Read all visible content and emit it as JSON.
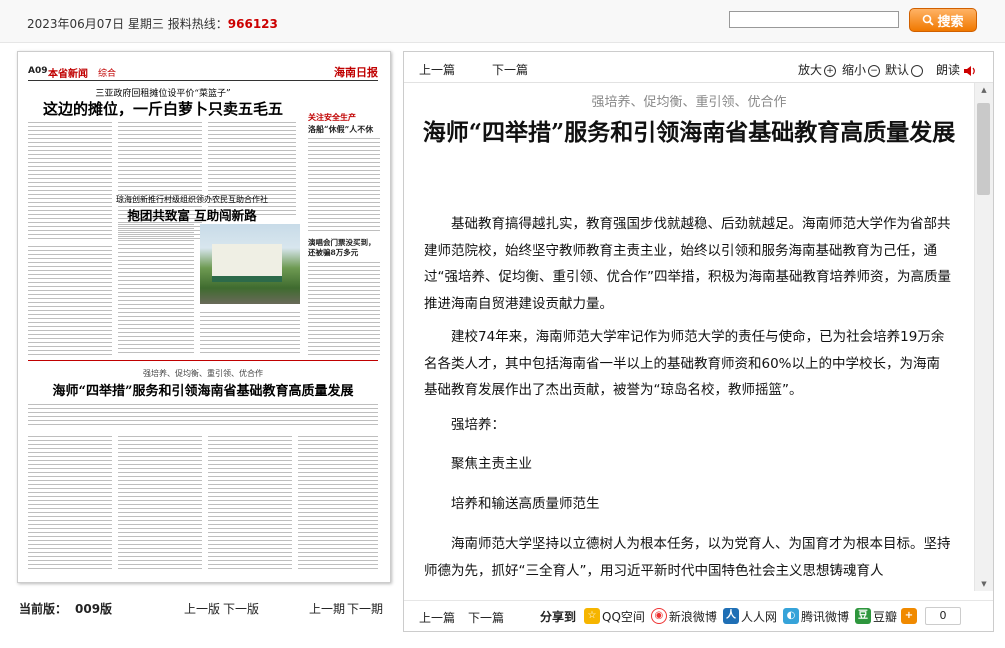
{
  "topbar": {
    "date": "2023年06月07日",
    "weekday": "星期三",
    "hotline_label": "报料热线：",
    "hotline_number": "966123",
    "search_placeholder": "",
    "search_button": "搜索"
  },
  "paper": {
    "page_code": "A09",
    "section": "本省新闻",
    "section_sub": "综合",
    "masthead": "海南日报",
    "headline1_kicker": "三亚政府回租摊位设平价“菜篮子”",
    "headline1": "这边的摊位，一斤白萝卜只卖五毛五",
    "headline2_kicker": "琼海创新推行村级组织领办农民互助合作社",
    "headline2": "抱团共致富 互助闯新路",
    "right_column_kicker": "关注安全生产",
    "right_column_title": "洛船“休假”人不休",
    "right_column_title2": "演唱会门票没买到，还被骗8万多元",
    "main_kicker": "强培养、促均衡、重引领、优合作",
    "main_headline": "海师“四举措”服务和引领海南省基础教育高质量发展"
  },
  "left_nav": {
    "current_label": "当前版：",
    "current_value": "009版",
    "prev_page": "上一版",
    "next_page": "下一版",
    "prev_issue": "上一期",
    "next_issue": "下一期"
  },
  "toolbar": {
    "prev_article": "上一篇",
    "next_article": "下一篇",
    "zoom_in": "放大",
    "zoom_out": "缩小",
    "default": "默认",
    "read_aloud": "朗读"
  },
  "article": {
    "subtitle": "强培养、促均衡、重引领、优合作",
    "title": "海师“四举措”服务和引领海南省基础教育高质量发展",
    "paragraphs": [
      "基础教育搞得越扎实，教育强国步伐就越稳、后劲就越足。海南师范大学作为省部共建师范院校，始终坚守教师教育主责主业，始终以引领和服务海南基础教育为己任，通过“强培养、促均衡、重引领、优合作”四举措，积极为海南基础教育培养师资，为高质量推进海南自贸港建设贡献力量。",
      "建校74年来，海南师范大学牢记作为师范大学的责任与使命，已为社会培养19万余名各类人才，其中包括海南省一半以上的基础教育师资和60%以上的中学校长，为海南基础教育发展作出了杰出贡献，被誉为“琼岛名校，教师摇篮”。",
      "强培养：",
      "聚焦主责主业",
      "培养和输送高质量师范生",
      "海南师范大学坚持以立德树人为根本任务，以为党育人、为国育才为根本目标。坚持师德为先，抓好“三全育人”，用习近平新时代中国特色社会主义思想铸魂育人"
    ]
  },
  "footbar": {
    "prev_article": "上一篇",
    "next_article": "下一篇",
    "share_label": "分享到",
    "share_items": [
      "QQ空间",
      "新浪微博",
      "人人网",
      "腾讯微博",
      "豆瓣"
    ],
    "share_count": "0"
  },
  "colors": {
    "hotline": "#cc0000",
    "search_button": "#f07800",
    "paper_red": "#c00000"
  }
}
